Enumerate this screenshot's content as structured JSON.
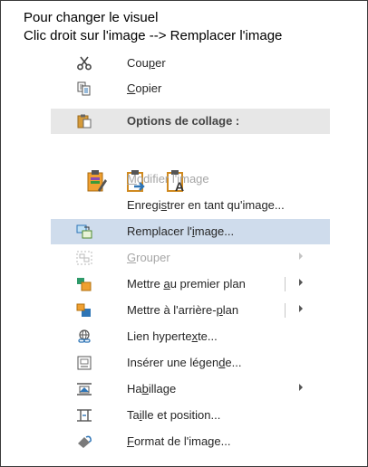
{
  "caption": {
    "line1": "Pour changer le visuel",
    "line2": "Clic droit sur l'image --> Remplacer l'image"
  },
  "menu": {
    "items": [
      {
        "id": "couper",
        "pre": "Cou",
        "u": "p",
        "post": "er",
        "icon": "scissors-icon",
        "enabled": true
      },
      {
        "id": "copier",
        "pre": "",
        "u": "C",
        "post": "opier",
        "icon": "copy-icon",
        "enabled": true
      },
      {
        "id": "options-collage",
        "label": "Options de collage :",
        "icon": "clipboard-icon",
        "header": true
      },
      {
        "id": "modifier",
        "pre": "",
        "u": "M",
        "post": "odifier l'image",
        "enabled": false
      },
      {
        "id": "enregistrer",
        "pre": "Enregi",
        "u": "s",
        "post": "trer en tant qu'image...",
        "enabled": true
      },
      {
        "id": "remplacer",
        "pre": "Remplacer l'",
        "u": "i",
        "post": "mage...",
        "icon": "change-picture-icon",
        "enabled": true,
        "highlighted": true
      },
      {
        "id": "grouper",
        "pre": "",
        "u": "G",
        "post": "rouper",
        "icon": "group-icon",
        "enabled": false,
        "submenu": true
      },
      {
        "id": "premier-plan",
        "pre": "Mettre ",
        "u": "a",
        "post": "u premier plan",
        "icon": "bring-forward-icon",
        "enabled": true,
        "submenu": true,
        "split": true
      },
      {
        "id": "arriere-plan",
        "pre": "Mettre à l'arrière-",
        "u": "p",
        "post": "lan",
        "icon": "send-backward-icon",
        "enabled": true,
        "submenu": true,
        "split": true
      },
      {
        "id": "lien",
        "pre": "Lien hyperte",
        "u": "x",
        "post": "te...",
        "icon": "link-icon",
        "enabled": true
      },
      {
        "id": "legende",
        "pre": "Insérer une légen",
        "u": "d",
        "post": "e...",
        "icon": "caption-icon",
        "enabled": true
      },
      {
        "id": "habillage",
        "pre": "Ha",
        "u": "b",
        "post": "illage",
        "icon": "wrap-text-icon",
        "enabled": true,
        "submenu": true
      },
      {
        "id": "taille",
        "pre": "Ta",
        "u": "i",
        "post": "lle et position...",
        "icon": "size-position-icon",
        "enabled": true
      },
      {
        "id": "format",
        "pre": "",
        "u": "F",
        "post": "ormat de l'image...",
        "icon": "format-picture-icon",
        "enabled": true
      }
    ],
    "paste_options": [
      {
        "name": "keep-source-formatting-icon"
      },
      {
        "name": "merge-formatting-icon"
      },
      {
        "name": "keep-text-only-icon"
      }
    ],
    "colors": {
      "highlight": "#cfdcec",
      "header": "#e7e7e7",
      "accent_blue": "#2e75b6",
      "clipboard_orange": "#f0a030"
    }
  }
}
